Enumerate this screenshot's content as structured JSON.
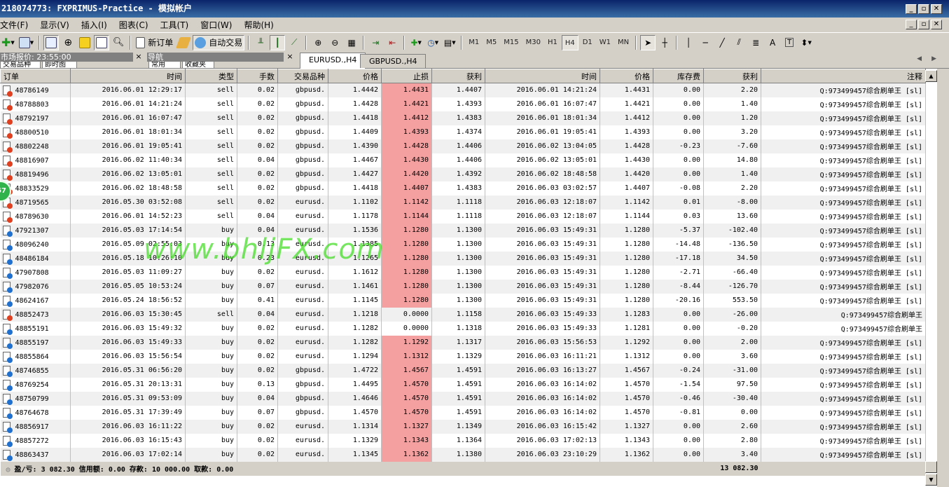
{
  "window": {
    "title": "218074773: FXPRIMUS-Practice - 模拟帐户"
  },
  "menu": [
    "文件(F)",
    "显示(V)",
    "插入(I)",
    "图表(C)",
    "工具(T)",
    "窗口(W)",
    "帮助(H)"
  ],
  "toolbar": {
    "new_order": "新订单",
    "auto_trading": "自动交易",
    "timeframes": [
      "M1",
      "M5",
      "M15",
      "M30",
      "H1",
      "H4",
      "D1",
      "W1",
      "MN"
    ],
    "active_timeframe": "H4"
  },
  "left_panel": {
    "market_watch_title": "市场报价: 23:55:00",
    "market_watch_tabs": [
      "交易品种",
      "即时图"
    ],
    "navigator_title": "导航",
    "navigator_tabs": [
      "常用",
      "收藏夹"
    ]
  },
  "chart_tabs": [
    "EURUSD.,H4",
    "GBPUSD.,H4"
  ],
  "active_chart_tab": 0,
  "badge": "57",
  "watermark": "www.bhljFX.com",
  "history": {
    "columns": [
      "订单",
      "时间",
      "类型",
      "手数",
      "交易品种",
      "价格",
      "止损",
      "获利",
      "时间",
      "价格",
      "库存费",
      "获利",
      "注释"
    ],
    "rows": [
      [
        "48786149",
        "2016.06.01 12:29:17",
        "sell",
        "0.02",
        "gbpusd.",
        "1.4442",
        "1.4431",
        "1.4407",
        "2016.06.01 14:21:24",
        "1.4431",
        "0.00",
        "2.20",
        "Q:973499457综合刷单王 [sl]"
      ],
      [
        "48788803",
        "2016.06.01 14:21:24",
        "sell",
        "0.02",
        "gbpusd.",
        "1.4428",
        "1.4421",
        "1.4393",
        "2016.06.01 16:07:47",
        "1.4421",
        "0.00",
        "1.40",
        "Q:973499457综合刷单王 [sl]"
      ],
      [
        "48792197",
        "2016.06.01 16:07:47",
        "sell",
        "0.02",
        "gbpusd.",
        "1.4418",
        "1.4412",
        "1.4383",
        "2016.06.01 18:01:34",
        "1.4412",
        "0.00",
        "1.20",
        "Q:973499457综合刷单王 [sl]"
      ],
      [
        "48800510",
        "2016.06.01 18:01:34",
        "sell",
        "0.02",
        "gbpusd.",
        "1.4409",
        "1.4393",
        "1.4374",
        "2016.06.01 19:05:41",
        "1.4393",
        "0.00",
        "3.20",
        "Q:973499457综合刷单王 [sl]"
      ],
      [
        "48802248",
        "2016.06.01 19:05:41",
        "sell",
        "0.02",
        "gbpusd.",
        "1.4390",
        "1.4428",
        "1.4406",
        "2016.06.02 13:04:05",
        "1.4428",
        "-0.23",
        "-7.60",
        "Q:973499457综合刷单王 [sl]"
      ],
      [
        "48816907",
        "2016.06.02 11:40:34",
        "sell",
        "0.04",
        "gbpusd.",
        "1.4467",
        "1.4430",
        "1.4406",
        "2016.06.02 13:05:01",
        "1.4430",
        "0.00",
        "14.80",
        "Q:973499457综合刷单王 [sl]"
      ],
      [
        "48819496",
        "2016.06.02 13:05:01",
        "sell",
        "0.02",
        "gbpusd.",
        "1.4427",
        "1.4420",
        "1.4392",
        "2016.06.02 18:48:58",
        "1.4420",
        "0.00",
        "1.40",
        "Q:973499457综合刷单王 [sl]"
      ],
      [
        "48833529",
        "2016.06.02 18:48:58",
        "sell",
        "0.02",
        "gbpusd.",
        "1.4418",
        "1.4407",
        "1.4383",
        "2016.06.03 03:02:57",
        "1.4407",
        "-0.08",
        "2.20",
        "Q:973499457综合刷单王 [sl]"
      ],
      [
        "48719565",
        "2016.05.30 03:52:08",
        "sell",
        "0.02",
        "eurusd.",
        "1.1102",
        "1.1142",
        "1.1118",
        "2016.06.03 12:18:07",
        "1.1142",
        "0.01",
        "-8.00",
        "Q:973499457综合刷单王 [sl]"
      ],
      [
        "48789630",
        "2016.06.01 14:52:23",
        "sell",
        "0.04",
        "eurusd.",
        "1.1178",
        "1.1144",
        "1.1118",
        "2016.06.03 12:18:07",
        "1.1144",
        "0.03",
        "13.60",
        "Q:973499457综合刷单王 [sl]"
      ],
      [
        "47921307",
        "2016.05.03 17:14:54",
        "buy",
        "0.04",
        "eurusd.",
        "1.1536",
        "1.1280",
        "1.1300",
        "2016.06.03 15:49:31",
        "1.1280",
        "-5.37",
        "-102.40",
        "Q:973499457综合刷单王 [sl]"
      ],
      [
        "48096240",
        "2016.05.09 02:55:03",
        "buy",
        "0.13",
        "eurusd.",
        "1.1385",
        "1.1280",
        "1.1300",
        "2016.06.03 15:49:31",
        "1.1280",
        "-14.48",
        "-136.50",
        "Q:973499457综合刷单王 [sl]"
      ],
      [
        "48486184",
        "2016.05.18 10:26:10",
        "buy",
        "0.23",
        "eurusd.",
        "1.1265",
        "1.1280",
        "1.1300",
        "2016.06.03 15:49:31",
        "1.1280",
        "-17.18",
        "34.50",
        "Q:973499457综合刷单王 [sl]"
      ],
      [
        "47907808",
        "2016.05.03 11:09:27",
        "buy",
        "0.02",
        "eurusd.",
        "1.1612",
        "1.1280",
        "1.1300",
        "2016.06.03 15:49:31",
        "1.1280",
        "-2.71",
        "-66.40",
        "Q:973499457综合刷单王 [sl]"
      ],
      [
        "47982076",
        "2016.05.05 10:53:24",
        "buy",
        "0.07",
        "eurusd.",
        "1.1461",
        "1.1280",
        "1.1300",
        "2016.06.03 15:49:31",
        "1.1280",
        "-8.44",
        "-126.70",
        "Q:973499457综合刷单王 [sl]"
      ],
      [
        "48624167",
        "2016.05.24 18:56:52",
        "buy",
        "0.41",
        "eurusd.",
        "1.1145",
        "1.1280",
        "1.1300",
        "2016.06.03 15:49:31",
        "1.1280",
        "-20.16",
        "553.50",
        "Q:973499457综合刷单王 [sl]"
      ],
      [
        "48852473",
        "2016.06.03 15:30:45",
        "sell",
        "0.04",
        "eurusd.",
        "1.1218",
        "0.0000",
        "1.1158",
        "2016.06.03 15:49:33",
        "1.1283",
        "0.00",
        "-26.00",
        "Q:973499457综合刷单王"
      ],
      [
        "48855191",
        "2016.06.03 15:49:32",
        "buy",
        "0.02",
        "eurusd.",
        "1.1282",
        "0.0000",
        "1.1318",
        "2016.06.03 15:49:33",
        "1.1281",
        "0.00",
        "-0.20",
        "Q:973499457综合刷单王"
      ],
      [
        "48855197",
        "2016.06.03 15:49:33",
        "buy",
        "0.02",
        "eurusd.",
        "1.1282",
        "1.1292",
        "1.1317",
        "2016.06.03 15:56:53",
        "1.1292",
        "0.00",
        "2.00",
        "Q:973499457综合刷单王 [sl]"
      ],
      [
        "48855864",
        "2016.06.03 15:56:54",
        "buy",
        "0.02",
        "eurusd.",
        "1.1294",
        "1.1312",
        "1.1329",
        "2016.06.03 16:11:21",
        "1.1312",
        "0.00",
        "3.60",
        "Q:973499457综合刷单王 [sl]"
      ],
      [
        "48746855",
        "2016.05.31 06:56:20",
        "buy",
        "0.02",
        "gbpusd.",
        "1.4722",
        "1.4567",
        "1.4591",
        "2016.06.03 16:13:27",
        "1.4567",
        "-0.24",
        "-31.00",
        "Q:973499457综合刷单王 [sl]"
      ],
      [
        "48769254",
        "2016.05.31 20:13:31",
        "buy",
        "0.13",
        "gbpusd.",
        "1.4495",
        "1.4570",
        "1.4591",
        "2016.06.03 16:14:02",
        "1.4570",
        "-1.54",
        "97.50",
        "Q:973499457综合刷单王 [sl]"
      ],
      [
        "48750799",
        "2016.05.31 09:53:09",
        "buy",
        "0.04",
        "gbpusd.",
        "1.4646",
        "1.4570",
        "1.4591",
        "2016.06.03 16:14:02",
        "1.4570",
        "-0.46",
        "-30.40",
        "Q:973499457综合刷单王 [sl]"
      ],
      [
        "48764678",
        "2016.05.31 17:39:49",
        "buy",
        "0.07",
        "gbpusd.",
        "1.4570",
        "1.4570",
        "1.4591",
        "2016.06.03 16:14:02",
        "1.4570",
        "-0.81",
        "0.00",
        "Q:973499457综合刷单王 [sl]"
      ],
      [
        "48856917",
        "2016.06.03 16:11:22",
        "buy",
        "0.02",
        "eurusd.",
        "1.1314",
        "1.1327",
        "1.1349",
        "2016.06.03 16:15:42",
        "1.1327",
        "0.00",
        "2.60",
        "Q:973499457综合刷单王 [sl]"
      ],
      [
        "48857272",
        "2016.06.03 16:15:43",
        "buy",
        "0.02",
        "eurusd.",
        "1.1329",
        "1.1343",
        "1.1364",
        "2016.06.03 17:02:13",
        "1.1343",
        "0.00",
        "2.80",
        "Q:973499457综合刷单王 [sl]"
      ],
      [
        "48863437",
        "2016.06.03 17:02:14",
        "buy",
        "0.02",
        "eurusd.",
        "1.1345",
        "1.1362",
        "1.1380",
        "2016.06.03 23:10:29",
        "1.1362",
        "0.00",
        "3.40",
        "Q:973499457综合刷单王 [sl]"
      ]
    ],
    "summary": "盈/亏: 3 082.30  信用额: 0.00  存款: 10 000.00  取款: 0.00",
    "summary_total": "13 082.30"
  },
  "colors": {
    "stop_loss_hit": "#f4a0a0",
    "row_alt": "#f0f0f0",
    "chrome": "#d4d0c8",
    "watermark": "#3cdc1e"
  }
}
